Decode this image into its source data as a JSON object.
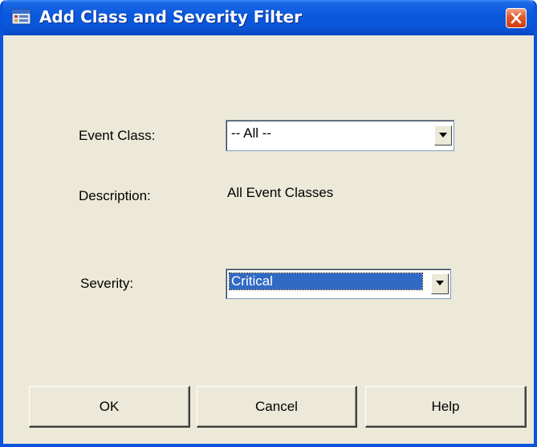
{
  "window": {
    "title": "Add Class and Severity Filter"
  },
  "icons": {
    "title_icon": "filter-dialog-icon",
    "close_icon": "close-icon",
    "dropdown_arrow": "chevron-down-icon"
  },
  "form": {
    "event_class_label": "Event Class:",
    "event_class_value": "-- All --",
    "description_label": "Description:",
    "description_value": "All Event Classes",
    "severity_label": "Severity:",
    "severity_value": "Critical"
  },
  "buttons": {
    "ok": "OK",
    "cancel": "Cancel",
    "help": "Help"
  },
  "colors": {
    "titlebar": "#0a58dc",
    "selection": "#316ac5",
    "dialog_background": "#ece9d8"
  }
}
